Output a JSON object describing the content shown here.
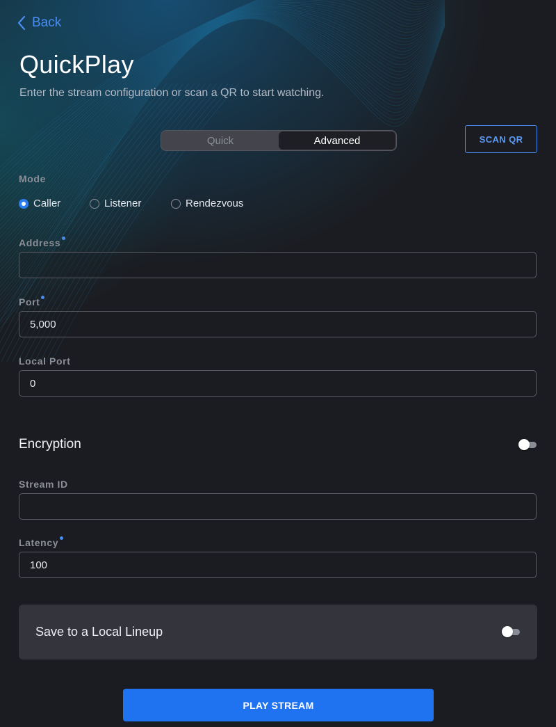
{
  "nav": {
    "back_label": "Back",
    "back_icon": "chevron-left-icon"
  },
  "header": {
    "title": "QuickPlay",
    "subtitle": "Enter the stream configuration or scan a QR to start watching."
  },
  "mode_tabs": [
    {
      "label": "Quick",
      "selected": false
    },
    {
      "label": "Advanced",
      "selected": true
    }
  ],
  "scan_qr_label": "SCAN QR",
  "mode": {
    "label": "Mode",
    "options": [
      {
        "label": "Caller",
        "selected": true
      },
      {
        "label": "Listener",
        "selected": false
      },
      {
        "label": "Rendezvous",
        "selected": false
      }
    ]
  },
  "fields": {
    "address": {
      "label": "Address",
      "required": true,
      "value": ""
    },
    "port": {
      "label": "Port",
      "required": true,
      "value": "5,000"
    },
    "local_port": {
      "label": "Local Port",
      "required": false,
      "value": "0"
    },
    "stream_id": {
      "label": "Stream ID",
      "required": false,
      "value": ""
    },
    "latency": {
      "label": "Latency",
      "required": true,
      "value": "100"
    }
  },
  "encryption": {
    "label": "Encryption",
    "enabled": false
  },
  "save_lineup": {
    "label": "Save to a Local Lineup",
    "enabled": false
  },
  "play_label": "PLAY STREAM",
  "colors": {
    "accent": "#1f72f0",
    "background": "#1b1c21",
    "card": "#33343c"
  }
}
